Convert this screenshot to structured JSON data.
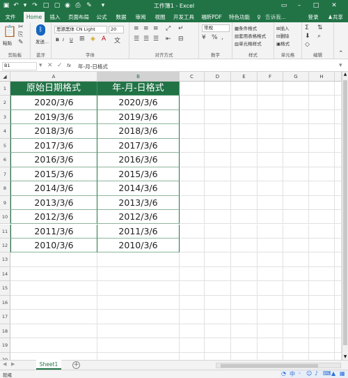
{
  "window": {
    "title": "工作簿1 - Excel",
    "share": "共享",
    "login": "登录"
  },
  "quick_access": [
    "save-icon",
    "undo-icon",
    "redo-icon",
    "new-icon",
    "open-icon",
    "camera-icon",
    "print-icon",
    "format-painter-icon",
    "more-icon"
  ],
  "tabs": [
    "文件",
    "Home",
    "插入",
    "页面布局",
    "公式",
    "数据",
    "审阅",
    "视图",
    "开发工具",
    "福昕PDF",
    "特色功能"
  ],
  "tellme": "告诉我...",
  "ribbon": {
    "paste": "粘贴",
    "bluetooth": "发送...",
    "font_name": "思源黑体 CN Light",
    "font_size": "20",
    "number_format": "常规",
    "cond_format": "条件格式",
    "table_format": "套用表格格式",
    "cell_style": "单元格样式",
    "insert": "插入",
    "delete": "删除",
    "format": "格式",
    "groups": [
      "剪贴板",
      "蓝牙",
      "字体",
      "对齐方式",
      "数字",
      "样式",
      "单元格",
      "编辑"
    ]
  },
  "formula": {
    "name_box": "B1",
    "fx": "fx",
    "content": "年-月-日格式"
  },
  "columns": [
    "A",
    "B",
    "C",
    "D",
    "E",
    "F",
    "G",
    "H"
  ],
  "rows": [
    "1",
    "2",
    "3",
    "4",
    "5",
    "6",
    "7",
    "8",
    "9",
    "10",
    "11",
    "12",
    "13",
    "14",
    "15",
    "16",
    "17",
    "18",
    "19",
    "20"
  ],
  "table": {
    "headers": [
      "原始日期格式",
      "年-月-日格式"
    ],
    "rows": [
      [
        "2020/3/6",
        "2020/3/6"
      ],
      [
        "2019/3/6",
        "2019/3/6"
      ],
      [
        "2018/3/6",
        "2018/3/6"
      ],
      [
        "2017/3/6",
        "2017/3/6"
      ],
      [
        "2016/3/6",
        "2016/3/6"
      ],
      [
        "2015/3/6",
        "2015/3/6"
      ],
      [
        "2014/3/6",
        "2014/3/6"
      ],
      [
        "2013/3/6",
        "2013/3/6"
      ],
      [
        "2012/3/6",
        "2012/3/6"
      ],
      [
        "2011/3/6",
        "2011/3/6"
      ],
      [
        "2010/3/6",
        "2010/3/6"
      ]
    ],
    "header_color": "#217346"
  },
  "sheet": {
    "tab": "Sheet1",
    "add": "+"
  },
  "status": {
    "ready": "就绪",
    "zoom": "100%"
  },
  "accent": "#217346"
}
